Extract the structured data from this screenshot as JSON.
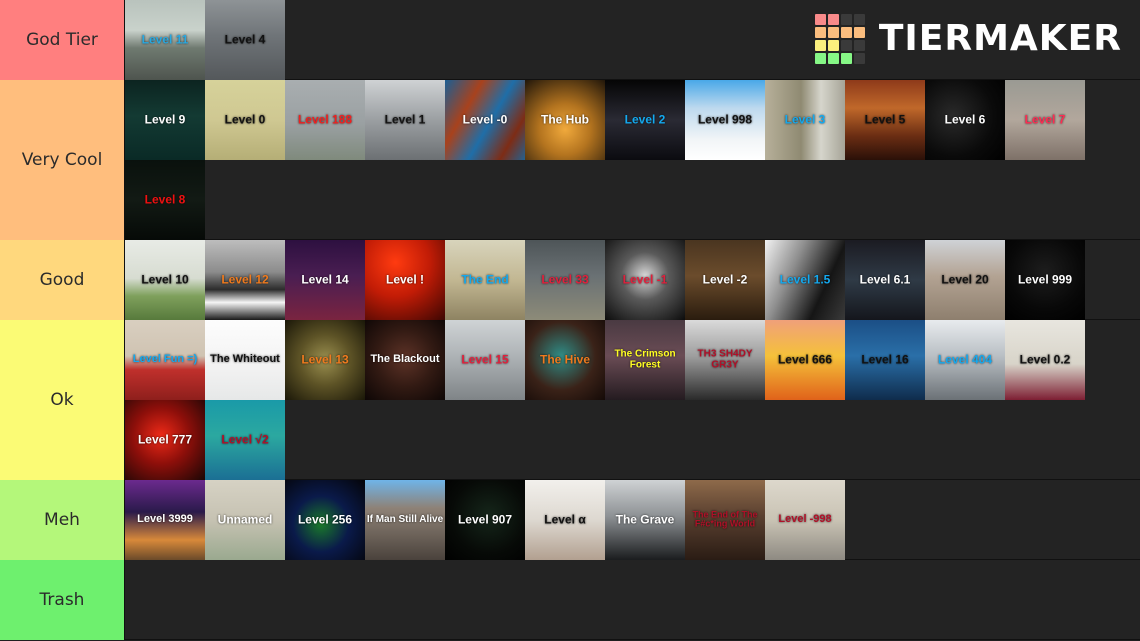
{
  "brand": {
    "name": "TIERMAKER",
    "logo_icon": "tier-grid-icon",
    "logo_colors": [
      [
        "#f98a8a",
        "#f98a8a",
        "#3a3a3a",
        "#3a3a3a"
      ],
      [
        "#fbbd7e",
        "#fbbd7e",
        "#fbbd7e",
        "#fbbd7e"
      ],
      [
        "#fbf07e",
        "#fbf07e",
        "#3a3a3a",
        "#3a3a3a"
      ],
      [
        "#86f786",
        "#86f786",
        "#86f786",
        "#3a3a3a"
      ]
    ]
  },
  "tiers": [
    {
      "label": "God Tier",
      "color": "#ff7f7f",
      "height": 80,
      "items": [
        {
          "label": "Level 11",
          "color": "#29a8e0",
          "art": "linear-gradient(#b9c3bd 0%, #c9d2cb 38%, #6f7a70 60%, #4e544e 100%)"
        },
        {
          "label": "Level 4",
          "color": "#111111",
          "art": "linear-gradient(#8e9396 0%, #6f7478 45%, #54585b 100%)"
        }
      ]
    },
    {
      "label": "Very Cool",
      "color": "#ffbe7d",
      "height": 160,
      "items": [
        {
          "label": "Level 9",
          "color": "#ffffff",
          "art": "linear-gradient(#0c2420 0%, #133a33 45%, #0a2a26 100%)"
        },
        {
          "label": "Level 0",
          "color": "#111111",
          "art": "linear-gradient(#d6d29a 0%, #cfc892 50%, #b5ae76 100%)"
        },
        {
          "label": "Level 188",
          "color": "#ef2020",
          "art": "linear-gradient(#a9aeb0 0%, #9aa0a2 55%, #7f8a7c 100%)"
        },
        {
          "label": "Level 1",
          "color": "#141414",
          "art": "linear-gradient(#cfd2d4 0%, #9b9fa2 50%, #6c7073 100%)"
        },
        {
          "label": "Level -0",
          "color": "#ffffff",
          "art": "linear-gradient(120deg,#1b5e94 0%, #a8421d 30%, #1f6ea8 55%, #7e2c15 80%, #24618f 100%)"
        },
        {
          "label": "The Hub",
          "color": "#ffffff",
          "art": "radial-gradient(circle at 50% 62%, #f0a93c 0%, #b4741f 40%, #20160a 100%)"
        },
        {
          "label": "Level 2",
          "color": "#14a9ef",
          "art": "linear-gradient(#050505 0%, #2a2a34 50%, #0b0b10 100%)"
        },
        {
          "label": "Level 998",
          "color": "#111111",
          "art": "linear-gradient(#49a8e8 0%, #bdd9ee 35%, #f2f5f7 75%, #ffffff 100%)"
        },
        {
          "label": "Level 3",
          "color": "#14a9ef",
          "art": "linear-gradient(90deg,#b7b09a 0%, #8f8a72 45%, #d6d5cc 70%, #a6a497 100%)"
        },
        {
          "label": "Level 5",
          "color": "#111111",
          "art": "linear-gradient(#8e3a1a 0%, #c0682a 35%, #6a2d13 70%, #2a1008 100%)"
        },
        {
          "label": "Level 6",
          "color": "#ffffff",
          "art": "radial-gradient(circle at 35% 45%, #2a2a2a 0%, #0a0a0a 60%, #000000 100%)"
        },
        {
          "label": "Level 7",
          "color": "#ff2b52",
          "art": "linear-gradient(#9a9a93 0%, #b2a79c 50%, #7e7168 100%)"
        },
        {
          "label": "Level 8",
          "color": "#ef1111",
          "art": "linear-gradient(#0a110d 0%, #121a14 50%, #060a07 100%)"
        }
      ]
    },
    {
      "label": "Good",
      "color": "#ffd87d",
      "height": 80,
      "items": [
        {
          "label": "Level 10",
          "color": "#111111",
          "art": "linear-gradient(#e8ebe6 0%, #d7dcd1 48%, #7fa05c 70%, #577a3c 100%)"
        },
        {
          "label": "Level 12",
          "color": "#ef7a1e",
          "art": "linear-gradient(#bdbdbd 0%, #8c8c8c 40%, #2c2c2c 62%, #f5f5f5 78%, #1a1a1a 100%)"
        },
        {
          "label": "Level 14",
          "color": "#ffffff",
          "art": "linear-gradient(#2d1040 0%, #4a1e52 45%, #7a2440 100%)"
        },
        {
          "label": "Level !",
          "color": "#ffffff",
          "art": "radial-gradient(circle at 38% 28%, #ff3b10 0%, #c21c06 45%, #3d0602 100%)"
        },
        {
          "label": "The End",
          "color": "#14a9ef",
          "art": "linear-gradient(#d8d4bc 0%, #c2b792 50%, #8e8362 100%)"
        },
        {
          "label": "Level 33",
          "color": "#e0203c",
          "art": "linear-gradient(#4e5558 0%, #6a7174 45%, #8d8b78 100%)"
        },
        {
          "label": "Level -1",
          "color": "#e0203c",
          "art": "radial-gradient(circle at 50% 45%, #d9d9d9 0%, #5a5a5a 40%, #0c0c0c 100%)"
        },
        {
          "label": "Level -2",
          "color": "#ffffff",
          "art": "linear-gradient(#4a3520 0%, #6b4c2c 45%, #2a1c0e 100%)"
        },
        {
          "label": "Level 1.5",
          "color": "#14a9ef",
          "art": "linear-gradient(115deg,#f2f2f2 0%, #8e8e8e 35%, #151515 70%, #3a3a3a 100%)"
        },
        {
          "label": "Level 6.1",
          "color": "#ffffff",
          "art": "linear-gradient(#1b1b22 0%, #2f3a46 50%, #14161c 100%)"
        },
        {
          "label": "Level 20",
          "color": "#111111",
          "art": "linear-gradient(#cfd2d6 0%, #b3a393 45%, #8e7f6e 100%)"
        },
        {
          "label": "Level 999",
          "color": "#ffffff",
          "art": "radial-gradient(circle at 50% 40%, #1d1d1d 0%, #080808 60%, #000000 100%)"
        }
      ]
    },
    {
      "label": "Ok",
      "color": "#fbfb75",
      "height": 160,
      "items": [
        {
          "label": "Level Fun =)",
          "color": "#14a9ef",
          "art": "linear-gradient(#d9cfc0 0%, #cfc3b2 45%, #c0302c 62%, #8e1f1c 100%)"
        },
        {
          "label": "The Whiteout",
          "color": "#111111",
          "art": "linear-gradient(#fdfdfd 0%, #f2f2f2 60%, #e6e8e8 100%)"
        },
        {
          "label": "Level 13",
          "color": "#ef7a1e",
          "art": "radial-gradient(circle at 50% 50%, #9b9050 0%, #5d5326 45%, #1a1708 100%)"
        },
        {
          "label": "The Blackout",
          "color": "#ffffff",
          "art": "radial-gradient(circle at 50% 48%, #5e3327 0%, #321a13 50%, #0d0605 100%)"
        },
        {
          "label": "Level 15",
          "color": "#e0203c",
          "art": "linear-gradient(#cfd3d5 0%, #aeb3b6 45%, #7f8487 100%)"
        },
        {
          "label": "The Hive",
          "color": "#ef7a1e",
          "art": "radial-gradient(circle at 45% 45%, #2f8c86 0%, #3a2218 55%, #140a07 100%)"
        },
        {
          "label": "The Crimson Forest",
          "color": "#ffff22",
          "art": "linear-gradient(#4a3a42 0%, #6a4c55 45%, #241b20 100%)"
        },
        {
          "label": "TH3 SH4DY GR3Y",
          "color": "#b01028",
          "art": "linear-gradient(#dadada 0%, #9e9e9e 45%, #2a2a2a 100%)"
        },
        {
          "label": "Level 666",
          "color": "#111111",
          "art": "linear-gradient(#f0a07a 0%, #f5c13a 45%, #e0621a 100%)"
        },
        {
          "label": "Level 16",
          "color": "#111111",
          "art": "linear-gradient(#1b4f86 0%, #2a6fa8 45%, #0f2c4c 100%)"
        },
        {
          "label": "Level 404",
          "color": "#14a9ef",
          "art": "linear-gradient(#e8ebee 0%, #b9bfc4 45%, #6b7176 100%)"
        },
        {
          "label": "Level 0.2",
          "color": "#111111",
          "art": "linear-gradient(#e8e6df 0%, #d8d4c9 55%, #7d1f33 100%)"
        },
        {
          "label": "Level 777",
          "color": "#ffffff",
          "art": "radial-gradient(circle at 45% 45%, #ef2a18 0%, #8e0f0a 45%, #1a0605 100%)"
        },
        {
          "label": "Level √2",
          "color": "#b01028",
          "art": "linear-gradient(#1a9aa8 0%, #2ba8a0 45%, #1b6f94 100%)"
        }
      ]
    },
    {
      "label": "Meh",
      "color": "#b4f77a",
      "height": 80,
      "items": [
        {
          "label": "Level 3999",
          "color": "#ffffff",
          "art": "linear-gradient(#6b2a8e 0%, #2a1a4a 40%, #d8893a 75%, #6b4a2a 100%)"
        },
        {
          "label": "Unnamed",
          "color": "#ffffff",
          "art": "linear-gradient(#d6d2c4 0%, #c6c2b2 50%, #9aa98f 100%)"
        },
        {
          "label": "Level 256",
          "color": "#ffffff",
          "art": "radial-gradient(circle at 45% 55%, #1a7a2a 0%, #0a1a4a 45%, #040408 100%)"
        },
        {
          "label": "If Man Still Alive",
          "color": "#ffffff",
          "art": "linear-gradient(#6fb4e8 0%, #8e8277 35%, #6b6158 70%, #4a423c 100%)"
        },
        {
          "label": "Level 907",
          "color": "#ffffff",
          "art": "radial-gradient(circle at 55% 45%, #15261a 0%, #070a07 60%, #000000 100%)"
        },
        {
          "label": "Level α",
          "color": "#111111",
          "art": "linear-gradient(#f2f0ec 0%, #ddd8d0 50%, #b2a090 100%)"
        },
        {
          "label": "The Grave",
          "color": "#ffffff",
          "art": "linear-gradient(#cfd2d4 0%, #8e9295 45%, #1a1c1e 100%)"
        },
        {
          "label": "The End of The F#c*ing World",
          "color": "#b01028",
          "art": "linear-gradient(#8e6a4a 0%, #5a4030 45%, #2a1c14 100%)"
        },
        {
          "label": "Level -998",
          "color": "#b01028",
          "art": "linear-gradient(#ddd8cc 0%, #c9c3b4 50%, #8e8a82 100%)"
        }
      ]
    },
    {
      "label": "Trash",
      "color": "#6ef06e",
      "height": 80,
      "items": []
    }
  ]
}
